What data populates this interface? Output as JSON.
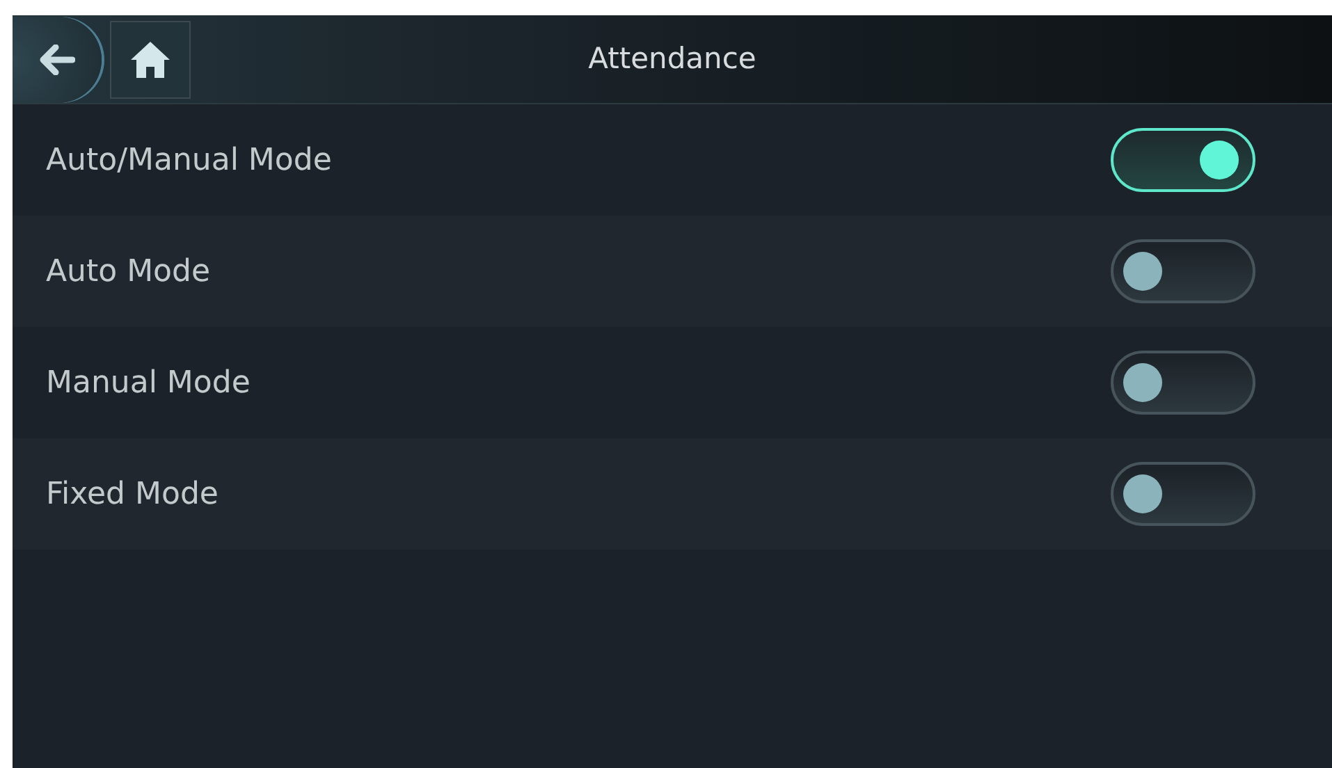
{
  "header": {
    "title": "Attendance"
  },
  "settings": [
    {
      "label": "Auto/Manual Mode",
      "on": true
    },
    {
      "label": "Auto Mode",
      "on": false
    },
    {
      "label": "Manual Mode",
      "on": false
    },
    {
      "label": "Fixed Mode",
      "on": false
    }
  ]
}
